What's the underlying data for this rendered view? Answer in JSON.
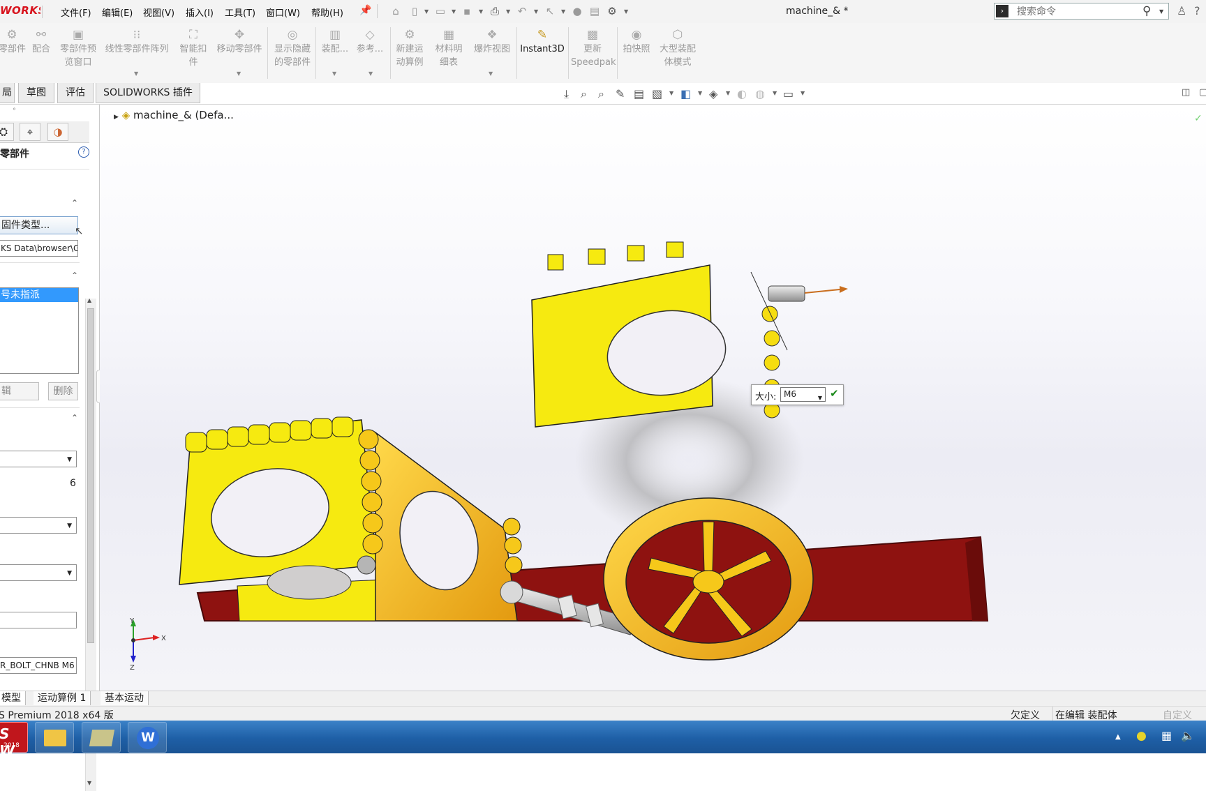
{
  "app": {
    "brand": "WORKS",
    "doc_title": "machine_& *"
  },
  "menu": [
    "文件(F)",
    "编辑(E)",
    "视图(V)",
    "插入(I)",
    "工具(T)",
    "窗口(W)",
    "帮助(H)"
  ],
  "search": {
    "placeholder": "搜索命令"
  },
  "ribbon": [
    {
      "label": "零部件",
      "icon": "insert-component-icon",
      "enabled": false
    },
    {
      "label": "配合",
      "icon": "mate-icon",
      "enabled": false
    },
    {
      "label": "零部件预\n览窗口",
      "icon": "component-preview-icon",
      "enabled": false
    },
    {
      "label": "线性零部件阵列",
      "icon": "linear-pattern-icon",
      "enabled": false
    },
    {
      "label": "智能扣\n件",
      "icon": "smart-fasteners-icon",
      "enabled": false
    },
    {
      "label": "移动零部件",
      "icon": "move-component-icon",
      "enabled": false
    },
    {
      "label": "显示隐藏\n的零部件",
      "icon": "show-hidden-icon",
      "enabled": false
    },
    {
      "label": "装配...",
      "icon": "assembly-features-icon",
      "enabled": false
    },
    {
      "label": "参考...",
      "icon": "reference-geometry-icon",
      "enabled": false
    },
    {
      "label": "新建运\n动算例",
      "icon": "new-motion-study-icon",
      "enabled": false
    },
    {
      "label": "材料明\n细表",
      "icon": "bom-icon",
      "enabled": false
    },
    {
      "label": "爆炸视图",
      "icon": "exploded-view-icon",
      "enabled": false
    },
    {
      "label": "Instant3D",
      "icon": "instant3d-icon",
      "enabled": true
    },
    {
      "label": "更新\nSpeedpak",
      "icon": "speedpak-icon",
      "enabled": false
    },
    {
      "label": "拍快照",
      "icon": "snapshot-icon",
      "enabled": false
    },
    {
      "label": "大型装配\n体模式",
      "icon": "large-assembly-icon",
      "enabled": false
    }
  ],
  "tabs": [
    "局",
    "草图",
    "评估",
    "SOLIDWORKS 插件"
  ],
  "tree": {
    "root": "machine_&  (Defa..."
  },
  "property_manager": {
    "title": "零部件",
    "fastener_button": "固件类型...",
    "path_value": "KS Data\\browser\\G",
    "list_item": "号未指派",
    "edit_button": "辑",
    "delete_button": "删除",
    "number_value": "6",
    "part_name": "R_BOLT_CHNB M6"
  },
  "size_popup": {
    "label": "大小:",
    "value": "M6"
  },
  "triad": {
    "x": "X",
    "y": "Y",
    "z": "Z"
  },
  "bottom_tabs": [
    "模型",
    "运动算例 1",
    "基本运动"
  ],
  "status": {
    "product": "S Premium 2018 x64 版",
    "under_defined": "欠定义",
    "editing": "在编辑 装配体",
    "custom": "自定义"
  },
  "taskbar": {
    "sw_badge": "S W",
    "sw_year": "2018"
  },
  "colors": {
    "part_yellow": "#f6ea10",
    "base_red": "#8e1210",
    "wheel_gold": "#f2c21a",
    "accent_red": "#d8141e"
  }
}
